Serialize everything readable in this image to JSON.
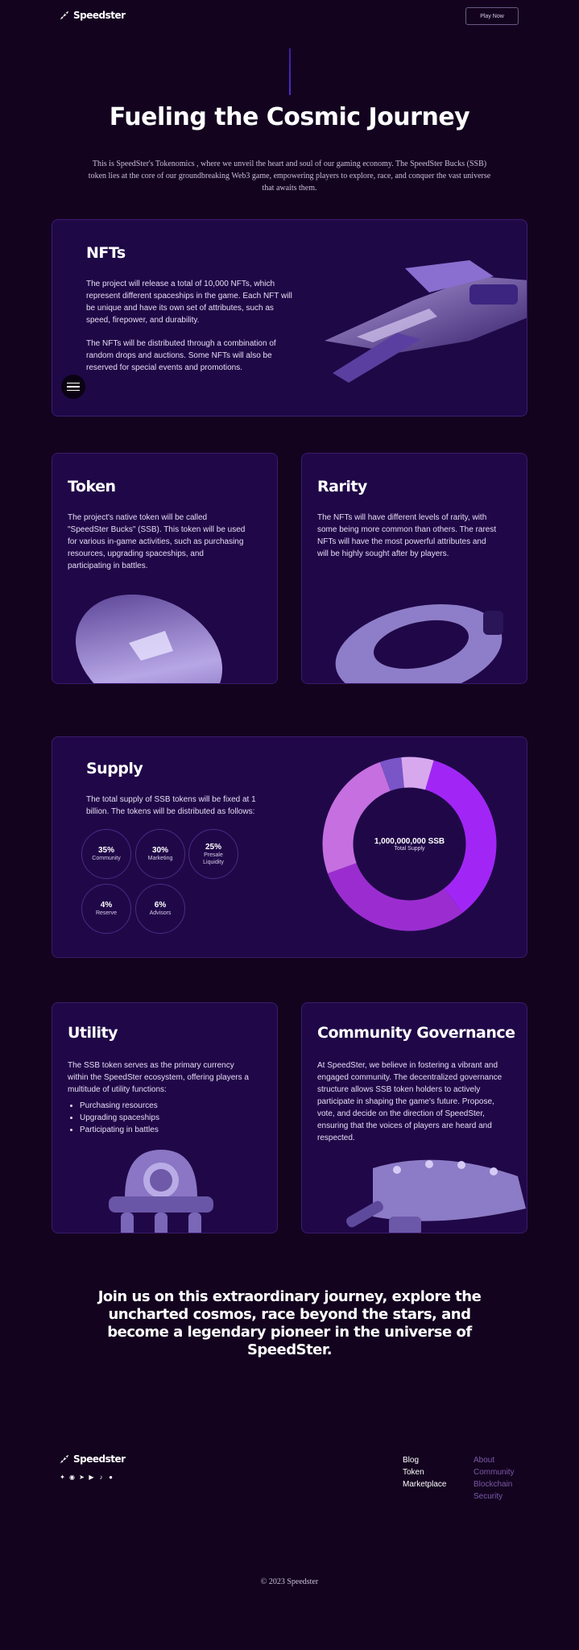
{
  "header": {
    "brand": "Speedster",
    "play_button": "Play Now"
  },
  "hero": {
    "title": "Fueling the Cosmic Journey",
    "description": "This is SpeedSter's Tokenomics , where we unveil the heart and soul of our gaming economy. The SpeedSter Bucks (SSB) token lies at the core of our groundbreaking Web3 game, empowering players to explore, race, and conquer the vast universe that awaits them."
  },
  "nfts": {
    "title": "NFTs",
    "p1": "The project will release a total of 10,000 NFTs, which represent different spaceships in the game. Each NFT will be unique and have its own set of attributes, such as speed, firepower, and durability.",
    "p2": "The NFTs will be distributed through a combination of random drops and auctions. Some NFTs will also be reserved for special events and promotions."
  },
  "token": {
    "title": "Token",
    "text": "The project's native token will be called \"SpeedSter Bucks\" (SSB). This token will be used for various in-game activities, such as purchasing resources, upgrading spaceships, and participating in battles."
  },
  "rarity": {
    "title": "Rarity",
    "text": "The NFTs will have different levels of rarity, with some being more common than others. The rarest NFTs will have the most powerful attributes and will be highly sought after by players."
  },
  "supply": {
    "title": "Supply",
    "text": "The total supply of SSB tokens will be fixed at 1 billion. The tokens will be distributed as follows:",
    "total_label": "1,000,000,000 SSB",
    "total_sub": "Total Supply",
    "allocations": [
      {
        "pct": "35%",
        "label": "Community"
      },
      {
        "pct": "30%",
        "label": "Marketing"
      },
      {
        "pct": "25%",
        "label": "Presale Liquidity"
      },
      {
        "pct": "4%",
        "label": "Reserve"
      },
      {
        "pct": "6%",
        "label": "Advisors"
      }
    ],
    "colors": [
      "#a126f5",
      "#9b2dd0",
      "#c66fe0",
      "#7a55c8",
      "#d8a8ef"
    ]
  },
  "chart_data": {
    "type": "pie",
    "categories": [
      "Community",
      "Marketing",
      "Presale Liquidity",
      "Reserve",
      "Advisors"
    ],
    "values": [
      35,
      30,
      25,
      4,
      6
    ]
  },
  "utility": {
    "title": "Utility",
    "text": "The SSB token serves as the primary currency within the SpeedSter ecosystem, offering players a multitude of utility functions:",
    "items": [
      "Purchasing resources",
      "Upgrading spaceships",
      "Participating in battles"
    ]
  },
  "community": {
    "title": "Community Governance",
    "text": "At SpeedSter, we believe in fostering a vibrant and engaged community. The decentralized governance structure allows SSB token holders to actively participate in shaping the game's future. Propose, vote, and decide on the direction of SpeedSter, ensuring that the voices of players are heard and respected."
  },
  "closing": "Join us on this extraordinary journey, explore the uncharted cosmos, race beyond the stars, and become a legendary pioneer in the universe of SpeedSter.",
  "footer": {
    "brand": "Speedster",
    "col1": [
      "Blog",
      "Token",
      "Marketplace"
    ],
    "col2": [
      "About",
      "Community",
      "Blockchain",
      "Security"
    ],
    "socials": [
      "twitter-icon",
      "discord-icon",
      "telegram-icon",
      "youtube-icon",
      "tiktok-icon",
      "medium-icon"
    ],
    "copyright": "© 2023 Speedster"
  }
}
